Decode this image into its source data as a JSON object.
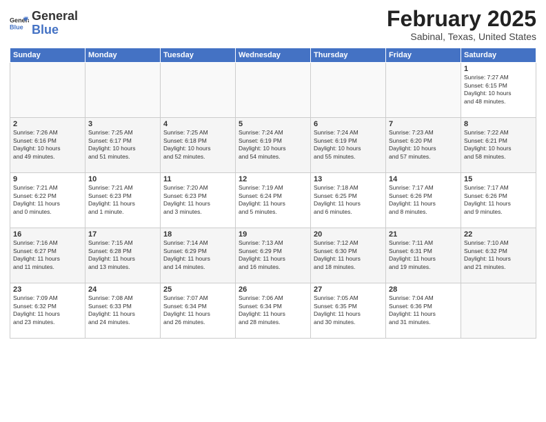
{
  "header": {
    "logo_line1": "General",
    "logo_line2": "Blue",
    "month_title": "February 2025",
    "subtitle": "Sabinal, Texas, United States"
  },
  "days_of_week": [
    "Sunday",
    "Monday",
    "Tuesday",
    "Wednesday",
    "Thursday",
    "Friday",
    "Saturday"
  ],
  "weeks": [
    [
      {
        "day": "",
        "info": ""
      },
      {
        "day": "",
        "info": ""
      },
      {
        "day": "",
        "info": ""
      },
      {
        "day": "",
        "info": ""
      },
      {
        "day": "",
        "info": ""
      },
      {
        "day": "",
        "info": ""
      },
      {
        "day": "1",
        "info": "Sunrise: 7:27 AM\nSunset: 6:15 PM\nDaylight: 10 hours\nand 48 minutes."
      }
    ],
    [
      {
        "day": "2",
        "info": "Sunrise: 7:26 AM\nSunset: 6:16 PM\nDaylight: 10 hours\nand 49 minutes."
      },
      {
        "day": "3",
        "info": "Sunrise: 7:25 AM\nSunset: 6:17 PM\nDaylight: 10 hours\nand 51 minutes."
      },
      {
        "day": "4",
        "info": "Sunrise: 7:25 AM\nSunset: 6:18 PM\nDaylight: 10 hours\nand 52 minutes."
      },
      {
        "day": "5",
        "info": "Sunrise: 7:24 AM\nSunset: 6:19 PM\nDaylight: 10 hours\nand 54 minutes."
      },
      {
        "day": "6",
        "info": "Sunrise: 7:24 AM\nSunset: 6:19 PM\nDaylight: 10 hours\nand 55 minutes."
      },
      {
        "day": "7",
        "info": "Sunrise: 7:23 AM\nSunset: 6:20 PM\nDaylight: 10 hours\nand 57 minutes."
      },
      {
        "day": "8",
        "info": "Sunrise: 7:22 AM\nSunset: 6:21 PM\nDaylight: 10 hours\nand 58 minutes."
      }
    ],
    [
      {
        "day": "9",
        "info": "Sunrise: 7:21 AM\nSunset: 6:22 PM\nDaylight: 11 hours\nand 0 minutes."
      },
      {
        "day": "10",
        "info": "Sunrise: 7:21 AM\nSunset: 6:23 PM\nDaylight: 11 hours\nand 1 minute."
      },
      {
        "day": "11",
        "info": "Sunrise: 7:20 AM\nSunset: 6:23 PM\nDaylight: 11 hours\nand 3 minutes."
      },
      {
        "day": "12",
        "info": "Sunrise: 7:19 AM\nSunset: 6:24 PM\nDaylight: 11 hours\nand 5 minutes."
      },
      {
        "day": "13",
        "info": "Sunrise: 7:18 AM\nSunset: 6:25 PM\nDaylight: 11 hours\nand 6 minutes."
      },
      {
        "day": "14",
        "info": "Sunrise: 7:17 AM\nSunset: 6:26 PM\nDaylight: 11 hours\nand 8 minutes."
      },
      {
        "day": "15",
        "info": "Sunrise: 7:17 AM\nSunset: 6:26 PM\nDaylight: 11 hours\nand 9 minutes."
      }
    ],
    [
      {
        "day": "16",
        "info": "Sunrise: 7:16 AM\nSunset: 6:27 PM\nDaylight: 11 hours\nand 11 minutes."
      },
      {
        "day": "17",
        "info": "Sunrise: 7:15 AM\nSunset: 6:28 PM\nDaylight: 11 hours\nand 13 minutes."
      },
      {
        "day": "18",
        "info": "Sunrise: 7:14 AM\nSunset: 6:29 PM\nDaylight: 11 hours\nand 14 minutes."
      },
      {
        "day": "19",
        "info": "Sunrise: 7:13 AM\nSunset: 6:29 PM\nDaylight: 11 hours\nand 16 minutes."
      },
      {
        "day": "20",
        "info": "Sunrise: 7:12 AM\nSunset: 6:30 PM\nDaylight: 11 hours\nand 18 minutes."
      },
      {
        "day": "21",
        "info": "Sunrise: 7:11 AM\nSunset: 6:31 PM\nDaylight: 11 hours\nand 19 minutes."
      },
      {
        "day": "22",
        "info": "Sunrise: 7:10 AM\nSunset: 6:32 PM\nDaylight: 11 hours\nand 21 minutes."
      }
    ],
    [
      {
        "day": "23",
        "info": "Sunrise: 7:09 AM\nSunset: 6:32 PM\nDaylight: 11 hours\nand 23 minutes."
      },
      {
        "day": "24",
        "info": "Sunrise: 7:08 AM\nSunset: 6:33 PM\nDaylight: 11 hours\nand 24 minutes."
      },
      {
        "day": "25",
        "info": "Sunrise: 7:07 AM\nSunset: 6:34 PM\nDaylight: 11 hours\nand 26 minutes."
      },
      {
        "day": "26",
        "info": "Sunrise: 7:06 AM\nSunset: 6:34 PM\nDaylight: 11 hours\nand 28 minutes."
      },
      {
        "day": "27",
        "info": "Sunrise: 7:05 AM\nSunset: 6:35 PM\nDaylight: 11 hours\nand 30 minutes."
      },
      {
        "day": "28",
        "info": "Sunrise: 7:04 AM\nSunset: 6:36 PM\nDaylight: 11 hours\nand 31 minutes."
      },
      {
        "day": "",
        "info": ""
      }
    ]
  ]
}
